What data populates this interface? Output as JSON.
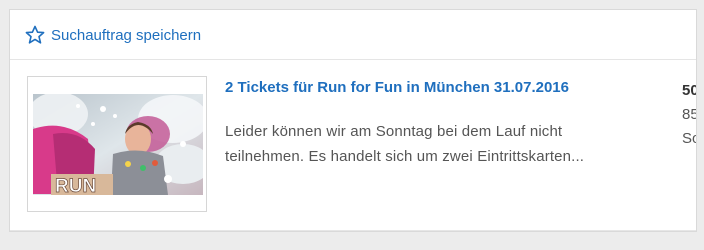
{
  "save_search": {
    "label": "Suchauftrag speichern",
    "icon": "star-outline-icon"
  },
  "listing": {
    "title": "2 Tickets für Run for Fun in München 31.07.2016",
    "description": "Leider können wir am Sonntag bei dem Lauf nicht teilnehmen. Es handelt sich um zwei Eintrittskarten...",
    "image_text": "RUN",
    "side_lines": [
      "50",
      "85",
      "So"
    ]
  },
  "colors": {
    "link": "#1f6fbe",
    "text": "#555555"
  }
}
